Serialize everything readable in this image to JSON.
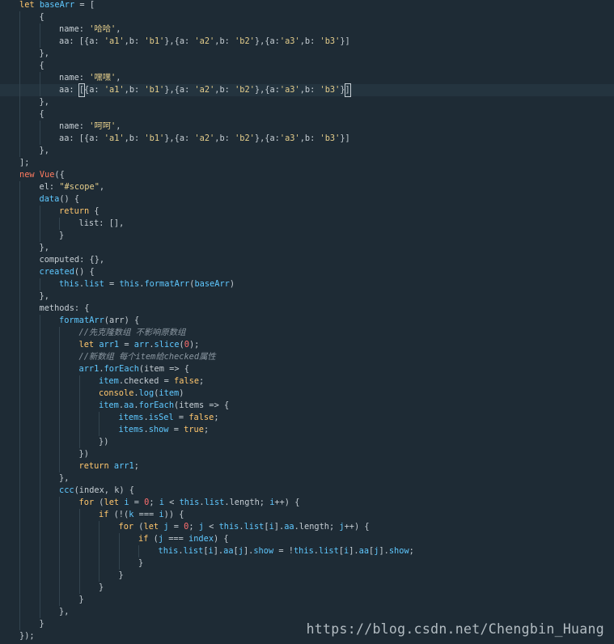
{
  "editor": {
    "lines": [
      {
        "indent": 0,
        "tokens": [
          [
            "k",
            "let "
          ],
          [
            "v",
            "baseArr"
          ],
          [
            "p",
            " = ["
          ]
        ]
      },
      {
        "indent": 1,
        "tokens": [
          [
            "p",
            "{"
          ]
        ]
      },
      {
        "indent": 2,
        "tokens": [
          [
            "p",
            "name: "
          ],
          [
            "s",
            "'哈哈'"
          ],
          [
            "p",
            ","
          ]
        ]
      },
      {
        "indent": 2,
        "tokens": [
          [
            "p",
            "aa: [{a: "
          ],
          [
            "s",
            "'a1'"
          ],
          [
            "p",
            ",b: "
          ],
          [
            "s",
            "'b1'"
          ],
          [
            "p",
            "},{a: "
          ],
          [
            "s",
            "'a2'"
          ],
          [
            "p",
            ",b: "
          ],
          [
            "s",
            "'b2'"
          ],
          [
            "p",
            "},{a:"
          ],
          [
            "s",
            "'a3'"
          ],
          [
            "p",
            ",b: "
          ],
          [
            "s",
            "'b3'"
          ],
          [
            "p",
            "}]"
          ]
        ]
      },
      {
        "indent": 1,
        "tokens": [
          [
            "p",
            "},"
          ]
        ]
      },
      {
        "indent": 1,
        "tokens": [
          [
            "p",
            "{"
          ]
        ]
      },
      {
        "indent": 2,
        "tokens": [
          [
            "p",
            "name: "
          ],
          [
            "s",
            "'嘿嘿'"
          ],
          [
            "p",
            ","
          ]
        ]
      },
      {
        "indent": 2,
        "active": true,
        "tokens": [
          [
            "p",
            "aa: "
          ],
          [
            "cursor",
            "["
          ],
          [
            "p",
            "{a: "
          ],
          [
            "s",
            "'a1'"
          ],
          [
            "p",
            ",b: "
          ],
          [
            "s",
            "'b1'"
          ],
          [
            "p",
            "},{a: "
          ],
          [
            "s",
            "'a2'"
          ],
          [
            "p",
            ",b: "
          ],
          [
            "s",
            "'b2'"
          ],
          [
            "p",
            "},{a:"
          ],
          [
            "s",
            "'a3'"
          ],
          [
            "p",
            ",b: "
          ],
          [
            "s",
            "'b3'"
          ],
          [
            "p",
            "}"
          ],
          [
            "cursor",
            "]"
          ]
        ]
      },
      {
        "indent": 1,
        "tokens": [
          [
            "p",
            "},"
          ]
        ]
      },
      {
        "indent": 1,
        "tokens": [
          [
            "p",
            "{"
          ]
        ]
      },
      {
        "indent": 2,
        "tokens": [
          [
            "p",
            "name: "
          ],
          [
            "s",
            "'呵呵'"
          ],
          [
            "p",
            ","
          ]
        ]
      },
      {
        "indent": 2,
        "tokens": [
          [
            "p",
            "aa: [{a: "
          ],
          [
            "s",
            "'a1'"
          ],
          [
            "p",
            ",b: "
          ],
          [
            "s",
            "'b1'"
          ],
          [
            "p",
            "},{a: "
          ],
          [
            "s",
            "'a2'"
          ],
          [
            "p",
            ",b: "
          ],
          [
            "s",
            "'b2'"
          ],
          [
            "p",
            "},{a:"
          ],
          [
            "s",
            "'a3'"
          ],
          [
            "p",
            ",b: "
          ],
          [
            "s",
            "'b3'"
          ],
          [
            "p",
            "}]"
          ]
        ]
      },
      {
        "indent": 1,
        "tokens": [
          [
            "p",
            "},"
          ]
        ]
      },
      {
        "indent": 0,
        "tokens": [
          [
            "p",
            "];"
          ]
        ]
      },
      {
        "indent": 0,
        "tokens": [
          [
            "kr",
            "new "
          ],
          [
            "kr",
            "Vue"
          ],
          [
            "p",
            "({"
          ]
        ]
      },
      {
        "indent": 1,
        "tokens": [
          [
            "p",
            "el: "
          ],
          [
            "s",
            "\"#scope\""
          ],
          [
            "p",
            ","
          ]
        ]
      },
      {
        "indent": 1,
        "tokens": [
          [
            "f",
            "data"
          ],
          [
            "p",
            "() {"
          ]
        ]
      },
      {
        "indent": 2,
        "tokens": [
          [
            "k",
            "return"
          ],
          [
            "p",
            " {"
          ]
        ]
      },
      {
        "indent": 3,
        "tokens": [
          [
            "p",
            "list: [],"
          ]
        ]
      },
      {
        "indent": 2,
        "tokens": [
          [
            "p",
            "}"
          ]
        ]
      },
      {
        "indent": 1,
        "tokens": [
          [
            "p",
            "},"
          ]
        ]
      },
      {
        "indent": 1,
        "tokens": [
          [
            "p",
            "computed: {},"
          ]
        ]
      },
      {
        "indent": 1,
        "tokens": [
          [
            "f",
            "created"
          ],
          [
            "p",
            "() {"
          ]
        ]
      },
      {
        "indent": 2,
        "tokens": [
          [
            "v",
            "this"
          ],
          [
            "p",
            "."
          ],
          [
            "v",
            "list"
          ],
          [
            "p",
            " = "
          ],
          [
            "v",
            "this"
          ],
          [
            "p",
            "."
          ],
          [
            "f",
            "formatArr"
          ],
          [
            "p",
            "("
          ],
          [
            "v",
            "baseArr"
          ],
          [
            "p",
            ")"
          ]
        ]
      },
      {
        "indent": 1,
        "tokens": [
          [
            "p",
            "},"
          ]
        ]
      },
      {
        "indent": 1,
        "tokens": [
          [
            "p",
            "methods: {"
          ]
        ]
      },
      {
        "indent": 2,
        "tokens": [
          [
            "f",
            "formatArr"
          ],
          [
            "p",
            "(arr) {"
          ]
        ]
      },
      {
        "indent": 3,
        "tokens": [
          [
            "c",
            "//先克隆数组 不影响原数组"
          ]
        ]
      },
      {
        "indent": 3,
        "tokens": [
          [
            "k",
            "let "
          ],
          [
            "v",
            "arr1"
          ],
          [
            "p",
            " = "
          ],
          [
            "v",
            "arr"
          ],
          [
            "p",
            "."
          ],
          [
            "f",
            "slice"
          ],
          [
            "p",
            "("
          ],
          [
            "n",
            "0"
          ],
          [
            "p",
            ");"
          ]
        ]
      },
      {
        "indent": 3,
        "tokens": [
          [
            "c",
            "//新数组 每个item给checked属性"
          ]
        ]
      },
      {
        "indent": 3,
        "tokens": [
          [
            "v",
            "arr1"
          ],
          [
            "p",
            "."
          ],
          [
            "f",
            "forEach"
          ],
          [
            "p",
            "(item => {"
          ]
        ]
      },
      {
        "indent": 4,
        "tokens": [
          [
            "v",
            "item"
          ],
          [
            "p",
            ".checked = "
          ],
          [
            "k",
            "false"
          ],
          [
            "p",
            ";"
          ]
        ]
      },
      {
        "indent": 4,
        "tokens": [
          [
            "k",
            "console"
          ],
          [
            "p",
            "."
          ],
          [
            "f",
            "log"
          ],
          [
            "p",
            "("
          ],
          [
            "v",
            "item"
          ],
          [
            "p",
            ")"
          ]
        ]
      },
      {
        "indent": 4,
        "tokens": [
          [
            "v",
            "item"
          ],
          [
            "p",
            "."
          ],
          [
            "v",
            "aa"
          ],
          [
            "p",
            "."
          ],
          [
            "f",
            "forEach"
          ],
          [
            "p",
            "(items => {"
          ]
        ]
      },
      {
        "indent": 5,
        "tokens": [
          [
            "v",
            "items"
          ],
          [
            "p",
            "."
          ],
          [
            "v",
            "isSel"
          ],
          [
            "p",
            " = "
          ],
          [
            "k",
            "false"
          ],
          [
            "p",
            ";"
          ]
        ]
      },
      {
        "indent": 5,
        "tokens": [
          [
            "v",
            "items"
          ],
          [
            "p",
            "."
          ],
          [
            "v",
            "show"
          ],
          [
            "p",
            " = "
          ],
          [
            "k",
            "true"
          ],
          [
            "p",
            ";"
          ]
        ]
      },
      {
        "indent": 4,
        "tokens": [
          [
            "p",
            "})"
          ]
        ]
      },
      {
        "indent": 3,
        "tokens": [
          [
            "p",
            "})"
          ]
        ]
      },
      {
        "indent": 3,
        "tokens": [
          [
            "k",
            "return "
          ],
          [
            "v",
            "arr1"
          ],
          [
            "p",
            ";"
          ]
        ]
      },
      {
        "indent": 2,
        "tokens": [
          [
            "p",
            "},"
          ]
        ]
      },
      {
        "indent": 2,
        "tokens": [
          [
            "f",
            "ccc"
          ],
          [
            "p",
            "(index, k) {"
          ]
        ]
      },
      {
        "indent": 3,
        "tokens": [
          [
            "k",
            "for"
          ],
          [
            "p",
            " ("
          ],
          [
            "k",
            "let "
          ],
          [
            "v",
            "i"
          ],
          [
            "p",
            " = "
          ],
          [
            "n",
            "0"
          ],
          [
            "p",
            "; "
          ],
          [
            "v",
            "i"
          ],
          [
            "p",
            " < "
          ],
          [
            "v",
            "this"
          ],
          [
            "p",
            "."
          ],
          [
            "v",
            "list"
          ],
          [
            "p",
            ".length; "
          ],
          [
            "v",
            "i"
          ],
          [
            "p",
            "++) {"
          ]
        ]
      },
      {
        "indent": 4,
        "tokens": [
          [
            "k",
            "if"
          ],
          [
            "p",
            " (!("
          ],
          [
            "v",
            "k"
          ],
          [
            "p",
            " === "
          ],
          [
            "v",
            "i"
          ],
          [
            "p",
            ")) {"
          ]
        ]
      },
      {
        "indent": 5,
        "tokens": [
          [
            "k",
            "for"
          ],
          [
            "p",
            " ("
          ],
          [
            "k",
            "let "
          ],
          [
            "v",
            "j"
          ],
          [
            "p",
            " = "
          ],
          [
            "n",
            "0"
          ],
          [
            "p",
            "; "
          ],
          [
            "v",
            "j"
          ],
          [
            "p",
            " < "
          ],
          [
            "v",
            "this"
          ],
          [
            "p",
            "."
          ],
          [
            "v",
            "list"
          ],
          [
            "p",
            "["
          ],
          [
            "v",
            "i"
          ],
          [
            "p",
            "]."
          ],
          [
            "v",
            "aa"
          ],
          [
            "p",
            ".length; "
          ],
          [
            "v",
            "j"
          ],
          [
            "p",
            "++) {"
          ]
        ]
      },
      {
        "indent": 6,
        "tokens": [
          [
            "k",
            "if"
          ],
          [
            "p",
            " ("
          ],
          [
            "v",
            "j"
          ],
          [
            "p",
            " === "
          ],
          [
            "v",
            "index"
          ],
          [
            "p",
            ") {"
          ]
        ]
      },
      {
        "indent": 7,
        "tokens": [
          [
            "v",
            "this"
          ],
          [
            "p",
            "."
          ],
          [
            "v",
            "list"
          ],
          [
            "p",
            "["
          ],
          [
            "v",
            "i"
          ],
          [
            "p",
            "]."
          ],
          [
            "v",
            "aa"
          ],
          [
            "p",
            "["
          ],
          [
            "v",
            "j"
          ],
          [
            "p",
            "]."
          ],
          [
            "v",
            "show"
          ],
          [
            "p",
            " = !"
          ],
          [
            "v",
            "this"
          ],
          [
            "p",
            "."
          ],
          [
            "v",
            "list"
          ],
          [
            "p",
            "["
          ],
          [
            "v",
            "i"
          ],
          [
            "p",
            "]."
          ],
          [
            "v",
            "aa"
          ],
          [
            "p",
            "["
          ],
          [
            "v",
            "j"
          ],
          [
            "p",
            "]."
          ],
          [
            "v",
            "show"
          ],
          [
            "p",
            ";"
          ]
        ]
      },
      {
        "indent": 6,
        "tokens": [
          [
            "p",
            "}"
          ]
        ]
      },
      {
        "indent": 5,
        "tokens": [
          [
            "p",
            "}"
          ]
        ]
      },
      {
        "indent": 4,
        "tokens": [
          [
            "p",
            "}"
          ]
        ]
      },
      {
        "indent": 3,
        "tokens": [
          [
            "p",
            "}"
          ]
        ]
      },
      {
        "indent": 2,
        "tokens": [
          [
            "p",
            "},"
          ]
        ]
      },
      {
        "indent": 1,
        "tokens": [
          [
            "p",
            "}"
          ]
        ]
      },
      {
        "indent": 0,
        "tokens": [
          [
            "p",
            "});"
          ]
        ]
      }
    ]
  },
  "watermark": {
    "text": "https://blog.csdn.net/Chengbin_Huang"
  }
}
